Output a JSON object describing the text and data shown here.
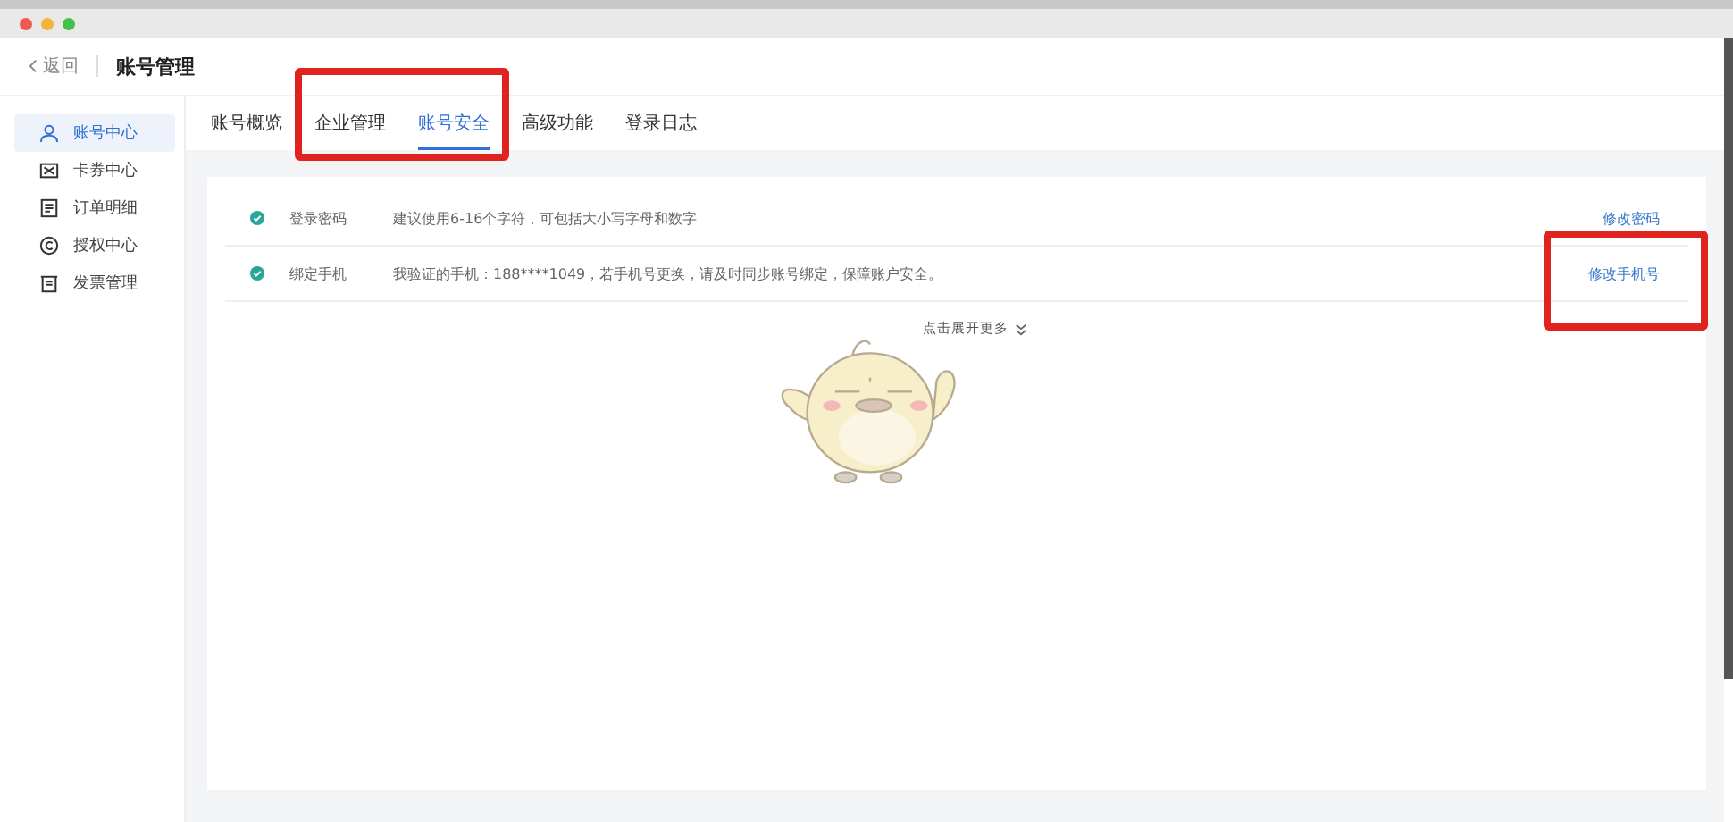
{
  "header": {
    "back": "返回",
    "title": "账号管理"
  },
  "sidebar": {
    "items": [
      {
        "label": "账号中心",
        "kind": "user",
        "selected": true
      },
      {
        "label": "卡券中心",
        "kind": "coupon",
        "selected": false
      },
      {
        "label": "订单明细",
        "kind": "list",
        "selected": false
      },
      {
        "label": "授权中心",
        "kind": "copyright",
        "selected": false
      },
      {
        "label": "发票管理",
        "kind": "invoice",
        "selected": false
      }
    ]
  },
  "tabs": [
    {
      "label": "账号概览",
      "selected": false
    },
    {
      "label": "企业管理",
      "selected": false
    },
    {
      "label": "账号安全",
      "selected": true
    },
    {
      "label": "高级功能",
      "selected": false
    },
    {
      "label": "登录日志",
      "selected": false
    }
  ],
  "security_items": [
    {
      "name": "登录密码",
      "verified": true,
      "description": "建议使用6-16个字符，可包括大小写字母和数字",
      "action": "修改密码"
    },
    {
      "name": "绑定手机",
      "verified": true,
      "description": "我验证的手机：188****1049，若手机号更换，请及时同步账号绑定，保障账户安全。",
      "action": "修改手机号"
    }
  ],
  "expand_more": "点击展开更多"
}
